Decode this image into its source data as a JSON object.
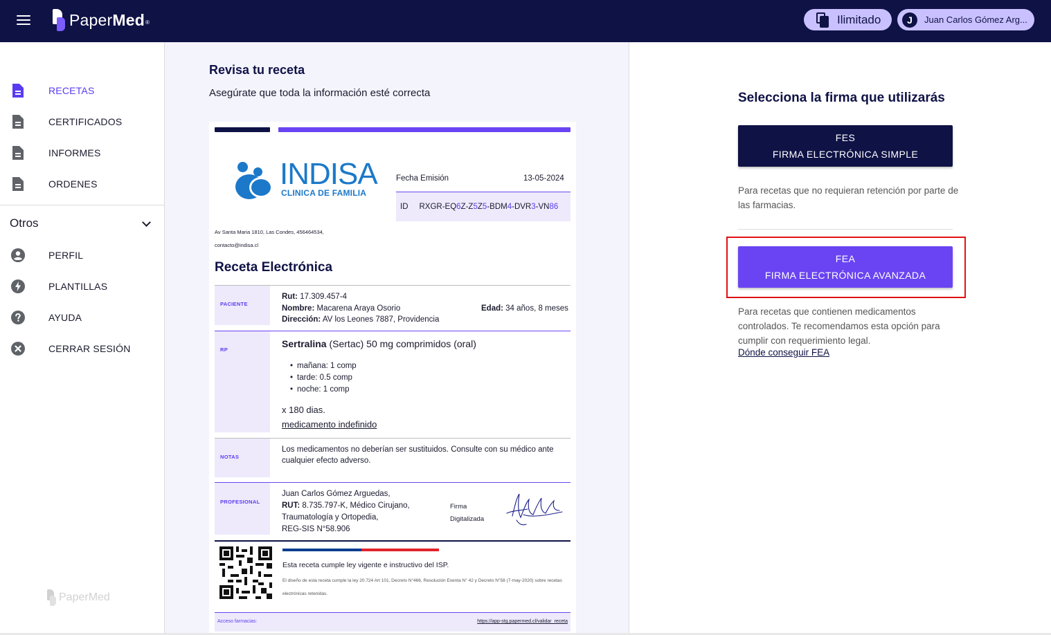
{
  "app": {
    "brand_light": "Paper",
    "brand_bold": "Med",
    "brand_mark": "®",
    "plan_label": "Ilimitado",
    "user_initial": "J",
    "user_name": "Juan Carlos Gómez Arg...",
    "colors": {
      "navy": "#0f1245",
      "violet": "#6a44f2",
      "highlight": "#e01010"
    }
  },
  "sidebar": {
    "main_items": [
      {
        "label": "RECETAS",
        "icon": "file-icon",
        "active": true
      },
      {
        "label": "CERTIFICADOS",
        "icon": "file-icon"
      },
      {
        "label": "INFORMES",
        "icon": "file-icon"
      },
      {
        "label": "ORDENES",
        "icon": "file-icon"
      }
    ],
    "section_label": "Otros",
    "other_items": [
      {
        "label": "PERFIL",
        "icon": "account-circle-icon"
      },
      {
        "label": "PLANTILLAS",
        "icon": "bolt-icon"
      },
      {
        "label": "AYUDA",
        "icon": "help-icon"
      },
      {
        "label": "CERRAR SESIÓN",
        "icon": "close-circle-icon"
      }
    ],
    "footer_logo": "PaperMed"
  },
  "review": {
    "title": "Revisa tu receta",
    "subtitle": "Asegúrate que toda la información esté correcta"
  },
  "prescription": {
    "clinic_name": "INDISA",
    "clinic_tagline": "CLINICA DE FAMILIA",
    "issue_label": "Fecha Emisión",
    "issue_date": "13-05-2024",
    "id_label": "ID",
    "id_parts": [
      "RXGR-EQ",
      "6",
      "Z-Z",
      "5",
      "Z",
      "5",
      "-BDM",
      "4",
      "-DVR",
      "3",
      "-VN",
      "86"
    ],
    "address_line1": "Av Santa Maria 1810, Las Condes, 456464534,",
    "address_line2": "contacto@indisa.cl",
    "title": "Receta Electrónica",
    "sections": {
      "patient": "PACIENTE",
      "rp": "RP",
      "notes": "NOTAS",
      "professional": "PROFESIONAL"
    },
    "patient": {
      "rut_label": "Rut:",
      "rut": "17.309.457-4",
      "name_label": "Nombre:",
      "name": "Macarena Araya Osorio",
      "age_label": "Edad:",
      "age": "34 años, 8 meses",
      "address_label": "Dirección:",
      "address": "AV los Leones 7887, Providencia"
    },
    "medication": {
      "name": "Sertralina",
      "detail": "(Sertac) 50 mg comprimidos (oral)",
      "doses": [
        "mañana: 1 comp",
        "tarde: 0.5 comp",
        "noche: 1 comp"
      ],
      "duration": "x 180 dias.",
      "indefinite": "medicamento indefinido"
    },
    "notes": "Los medicamentos no deberían ser sustituidos. Consulte con su médico ante cualquier efecto adverso.",
    "professional": {
      "name": "Juan Carlos Gómez Arguedas,",
      "rut_label": "RUT:",
      "rut": "8.735.797-K, Médico Cirujano,",
      "specialty": "Traumatología y Ortopedia,",
      "reg": "REG-SIS N°58.906",
      "sig_label_1": "Firma",
      "sig_label_2": "Digitalizada"
    },
    "isp_main": "Esta receta cumple ley vigente e instructivo del ISP.",
    "isp_small": "El diseño de esta receta cumple la ley 20.724 Art 101, Decreto N°466, Resolución Exenta N° 42 y Decreto N°58 (7-may-2020) sobre recetas electrónicas retenidas.",
    "pharmacy_label": "Acceso farmacias:",
    "pharmacy_link": "https://app-stg.papermed.cl/validar_receta"
  },
  "signature": {
    "title": "Selecciona la firma que utilizarás",
    "fes_code": "FES",
    "fes_name": "FIRMA ELECTRÓNICA SIMPLE",
    "fes_desc": "Para recetas que no requieran retención por parte de las farmacias.",
    "fea_code": "FEA",
    "fea_name": "FIRMA ELECTRÓNICA AVANZADA",
    "fea_desc": "Para recetas que contienen medicamentos controlados. Te recomendamos esta opción para cumplir con requerimiento legal.",
    "fea_link": "Dónde conseguir FEA"
  }
}
